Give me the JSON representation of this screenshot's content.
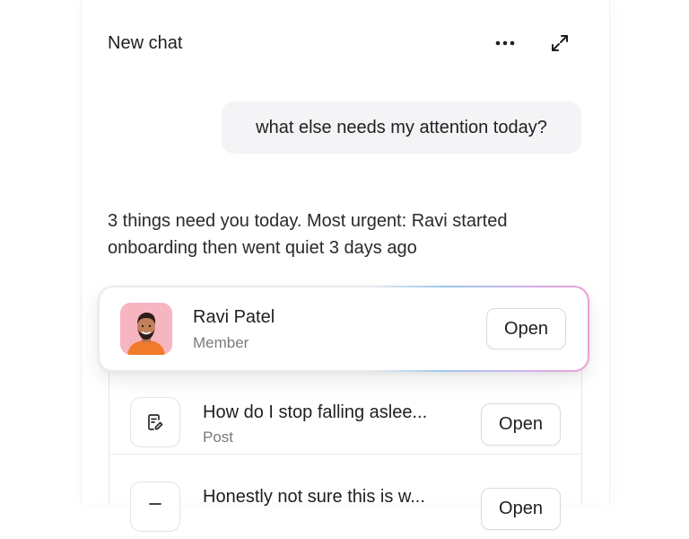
{
  "header": {
    "title": "New chat",
    "more_icon": "more-horizontal-icon",
    "expand_icon": "expand-icon"
  },
  "messages": {
    "user": "what else needs my attention today?",
    "assistant": "3 things need you today. Most urgent: Ravi started onboarding then went quiet 3 days ago"
  },
  "highlight_card": {
    "name": "Ravi Patel",
    "role": "Member",
    "button_label": "Open",
    "avatar_bg": "#f7b4c1"
  },
  "items": [
    {
      "title": "How do I stop falling aslee...",
      "subtitle": "Post",
      "button_label": "Open",
      "icon": "note-edit-icon"
    },
    {
      "title": "Honestly not sure this is w...",
      "button_label": "Open",
      "icon": "post-icon"
    }
  ],
  "colors": {
    "bubble_bg": "#f4f4f6",
    "glow_start": "#9cc8ef",
    "glow_mid": "#c9b5ef",
    "glow_end": "#ee9fd0"
  }
}
